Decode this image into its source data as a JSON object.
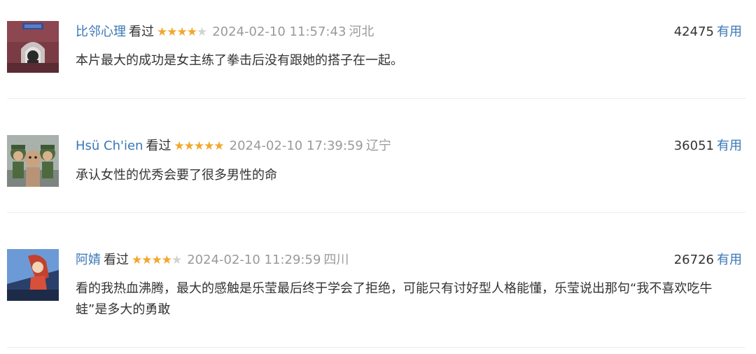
{
  "comments": [
    {
      "username": "比邻心理",
      "status": "看过",
      "rating": 4,
      "time": "2024-02-10 11:57:43",
      "location": "河北",
      "votes": "42475",
      "useful_label": "有用",
      "content": "本片最大的成功是女主练了拳击后没有跟她的搭子在一起。",
      "avatar_icon": "profile-photo-icon"
    },
    {
      "username": "Hsü Ch'ien",
      "status": "看过",
      "rating": 5,
      "time": "2024-02-10 17:39:59",
      "location": "辽宁",
      "votes": "36051",
      "useful_label": "有用",
      "content": "承认女性的优秀会要了很多男性的命",
      "avatar_icon": "cartoon-characters-icon"
    },
    {
      "username": "阿婧",
      "status": "看过",
      "rating": 4,
      "time": "2024-02-10 11:29:59",
      "location": "四川",
      "votes": "26726",
      "useful_label": "有用",
      "content": "看的我热血沸腾，最大的感触是乐莹最后终于学会了拒绝，可能只有讨好型人格能懂，乐莹说出那句“我不喜欢吃牛蛙”是多大的勇敢",
      "avatar_icon": "anime-girl-icon"
    }
  ],
  "colors": {
    "username": "#3a77b7",
    "star_on": "#f2a72b",
    "star_off": "#d2d2d2",
    "meta_gray": "#9a9a9a"
  }
}
